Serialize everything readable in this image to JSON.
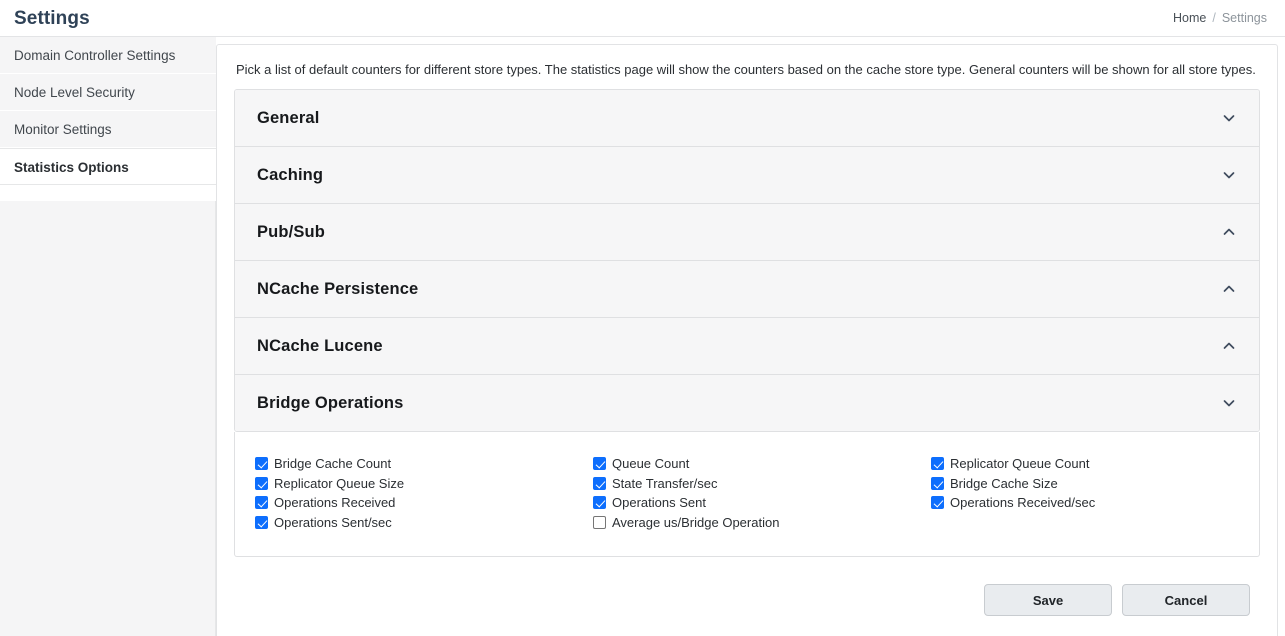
{
  "header": {
    "title": "Settings",
    "breadcrumb": {
      "home": "Home",
      "separator": "/",
      "current": "Settings"
    }
  },
  "sidebar": {
    "items": [
      {
        "label": "Domain Controller Settings",
        "active": false
      },
      {
        "label": "Node Level Security",
        "active": false
      },
      {
        "label": "Monitor Settings",
        "active": false
      },
      {
        "label": "Statistics Options",
        "active": true
      }
    ]
  },
  "main": {
    "description": "Pick a list of default counters for different store types. The statistics page will show the counters based on the cache store type. General counters will be shown for all store types.",
    "accordion": [
      {
        "title": "General",
        "icon": "chevron-down-icon",
        "expanded": false
      },
      {
        "title": "Caching",
        "icon": "chevron-down-icon",
        "expanded": false
      },
      {
        "title": "Pub/Sub",
        "icon": "chevron-up-icon",
        "expanded": false
      },
      {
        "title": "NCache Persistence",
        "icon": "chevron-up-icon",
        "expanded": false
      },
      {
        "title": "NCache Lucene",
        "icon": "chevron-up-icon",
        "expanded": false
      },
      {
        "title": "Bridge Operations",
        "icon": "chevron-down-icon",
        "expanded": true
      }
    ],
    "counters": {
      "column1": [
        {
          "label": "Bridge Cache Count",
          "checked": true
        },
        {
          "label": "Replicator Queue Size",
          "checked": true
        },
        {
          "label": "Operations Received",
          "checked": true
        },
        {
          "label": "Operations Sent/sec",
          "checked": true
        }
      ],
      "column2": [
        {
          "label": "Queue Count",
          "checked": true
        },
        {
          "label": "State Transfer/sec",
          "checked": true
        },
        {
          "label": "Operations Sent",
          "checked": true
        },
        {
          "label": "Average us/Bridge Operation",
          "checked": false
        }
      ],
      "column3": [
        {
          "label": "Replicator Queue Count",
          "checked": true
        },
        {
          "label": "Bridge Cache Size",
          "checked": true
        },
        {
          "label": "Operations Received/sec",
          "checked": true
        }
      ]
    },
    "buttons": {
      "save": "Save",
      "cancel": "Cancel"
    }
  },
  "colors": {
    "checkbox_accent": "#0d6efd",
    "title": "#2f4257",
    "accordion_header_bg": "#f6f6f7",
    "sidebar_bg": "#f5f5f6",
    "button_bg": "#e9ecef"
  }
}
